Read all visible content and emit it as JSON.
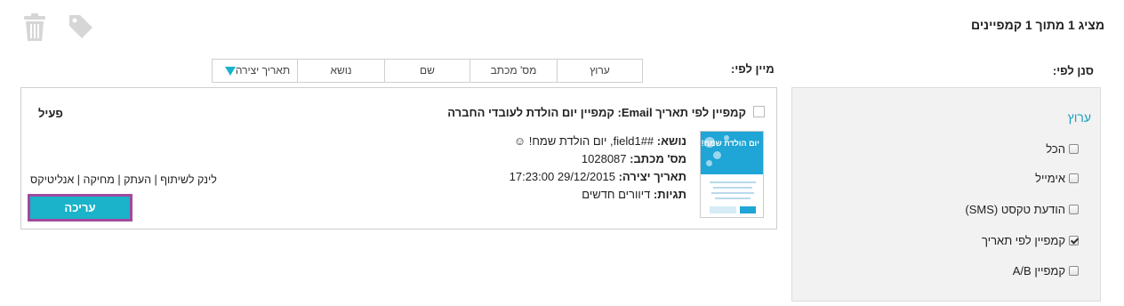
{
  "header": {
    "title": "מציג 1 מתוך 1 קמפיינים",
    "icons": [
      "trash-icon",
      "tag-icon"
    ]
  },
  "sort": {
    "label": "מיין לפי:",
    "tabs": [
      "ערוץ",
      "מס' מכתב",
      "שם",
      "נושא",
      "תאריך יצירה"
    ],
    "active_tab": "תאריך יצירה"
  },
  "filter": {
    "label": "סנן לפי:",
    "heading": "ערוץ",
    "options": [
      {
        "label": "הכל",
        "checked": false
      },
      {
        "label": "אימייל",
        "checked": false
      },
      {
        "label": "הודעת טקסט (SMS)",
        "checked": false
      },
      {
        "label": "קמפיין לפי תאריך",
        "checked": true
      },
      {
        "label": "קמפיין A/B",
        "checked": false
      }
    ]
  },
  "campaign": {
    "title": "קמפיין לפי תאריך Email:   קמפיין יום הולדת לעובדי החברה",
    "status": "פעיל",
    "thumbnail_text": "יום הולדת שמח!",
    "subject_label": "נושא:",
    "subject_value": "##field1, יום הולדת שמח! ☺",
    "letter_label": "מס' מכתב:",
    "letter_value": "1028087",
    "created_label": "תאריך יצירה:",
    "created_value": "29/12/2015 17:23:00",
    "tags_label": "תגיות:",
    "tags_value": "דיוורים חדשים",
    "links": [
      "לינק לשיתוף",
      "העתק",
      "מחיקה",
      "אנליטיקס"
    ],
    "edit_label": "עריכה"
  },
  "colors": {
    "accent": "#1ab3c9",
    "highlight_border": "#a04a9e",
    "filter_heading": "#1a9fc0",
    "panel_bg": "#f2f2f2"
  }
}
